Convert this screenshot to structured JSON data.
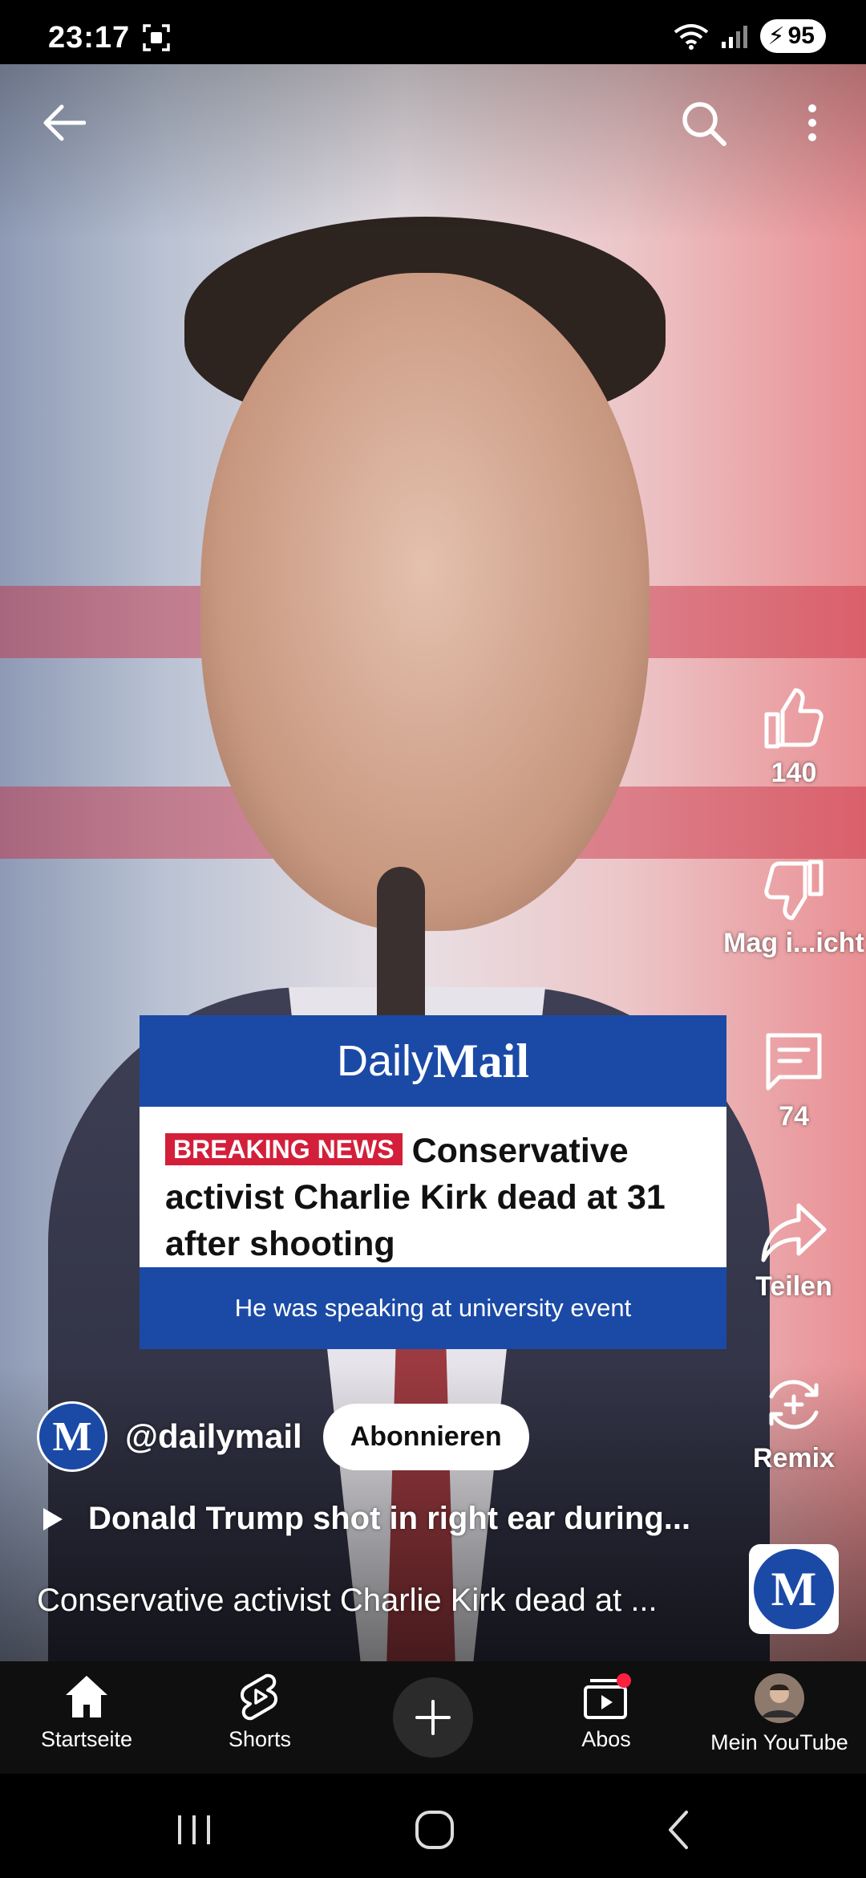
{
  "status_bar": {
    "time": "23:17",
    "battery": "95",
    "icons": [
      "screenshot-icon",
      "wifi-icon",
      "signal-icon",
      "battery-charging-icon"
    ]
  },
  "top_bar": {
    "icons": [
      "back-arrow-icon",
      "search-icon",
      "more-vert-icon"
    ]
  },
  "news_card": {
    "brand_light": "Daily",
    "brand_bold": "Mail",
    "badge": "BREAKING NEWS",
    "headline": "Conservative activist Charlie Kirk dead at 31 after shooting",
    "subline": "He was speaking at university event"
  },
  "actions": {
    "like_count": "140",
    "dislike_label": "Mag i...icht",
    "comment_count": "74",
    "share_label": "Teilen",
    "remix_label": "Remix"
  },
  "channel": {
    "avatar_letter": "M",
    "handle": "@dailymail",
    "subscribe_label": "Abonnieren"
  },
  "suggested": {
    "text": "Donald Trump shot in right ear during..."
  },
  "video_title": "Conservative activist Charlie Kirk dead at ...",
  "bottom_nav": {
    "home": "Startseite",
    "shorts": "Shorts",
    "subscriptions": "Abos",
    "you": "Mein YouTube"
  },
  "colors": {
    "daily_mail_blue": "#1b4aa6",
    "breaking_red": "#d31f3a",
    "nav_bg": "#0f0f0f"
  }
}
